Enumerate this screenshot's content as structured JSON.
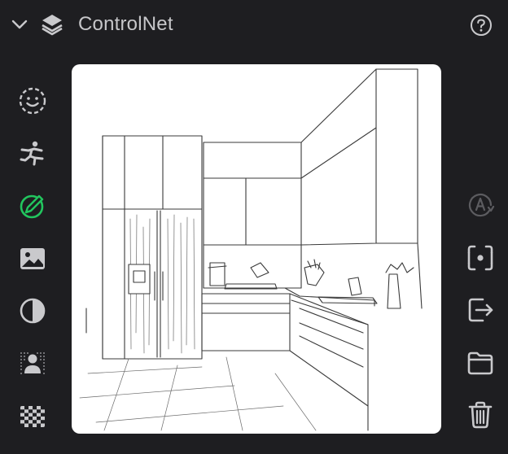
{
  "panel": {
    "title": "ControlNet",
    "collapse_icon": "chevron-down-icon",
    "header_icon": "stack-layers-icon",
    "help_icon": "question-circle-icon"
  },
  "left_tools": [
    {
      "name": "face-detect",
      "icon": "dashed-smiley-icon",
      "active": false
    },
    {
      "name": "pose",
      "icon": "running-figure-icon",
      "active": false
    },
    {
      "name": "scribble",
      "icon": "pencil-circle-icon",
      "active": true
    },
    {
      "name": "image",
      "icon": "image-icon",
      "active": false
    },
    {
      "name": "contrast",
      "icon": "half-circle-icon",
      "active": false
    },
    {
      "name": "portrait-depth",
      "icon": "person-dotted-icon",
      "active": false
    },
    {
      "name": "tile",
      "icon": "checkerboard-icon",
      "active": false
    }
  ],
  "right_tools": [
    {
      "name": "auto-annotate",
      "icon": "a-circle-icon",
      "enabled": false
    },
    {
      "name": "capture",
      "icon": "focus-frame-icon",
      "enabled": true
    },
    {
      "name": "export",
      "icon": "export-arrow-icon",
      "enabled": true
    },
    {
      "name": "open-folder",
      "icon": "folder-icon",
      "enabled": true
    },
    {
      "name": "delete",
      "icon": "trash-icon",
      "enabled": true
    }
  ],
  "preview": {
    "subject": "kitchen-sketch"
  },
  "colors": {
    "background": "#1e1e21",
    "icon": "#c9c9cc",
    "icon_disabled": "#5c5c60",
    "accent": "#22c55e",
    "canvas": "#ffffff"
  }
}
